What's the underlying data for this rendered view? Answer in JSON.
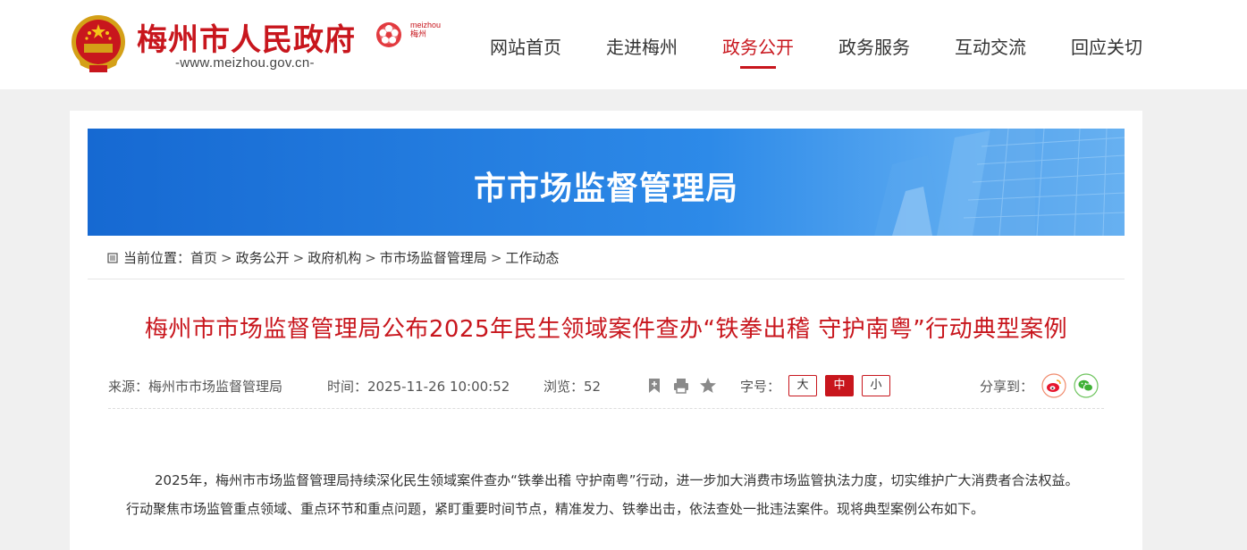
{
  "header": {
    "site_title": "梅州市人民政府",
    "site_url": "-www.meizhou.gov.cn-",
    "mz_logo_text_1": "meizhou",
    "mz_logo_text_2": "梅州"
  },
  "nav": {
    "items": [
      {
        "label": "网站首页",
        "active": false
      },
      {
        "label": "走进梅州",
        "active": false
      },
      {
        "label": "政务公开",
        "active": true
      },
      {
        "label": "政务服务",
        "active": false
      },
      {
        "label": "互动交流",
        "active": false
      },
      {
        "label": "回应关切",
        "active": false
      }
    ]
  },
  "banner": {
    "title": "市市场监督管理局"
  },
  "breadcrumb": {
    "prefix": "当前位置：",
    "items": [
      "首页",
      "政务公开",
      "政府机构",
      "市市场监督管理局",
      "工作动态"
    ],
    "separator": ">"
  },
  "article": {
    "title": "梅州市市场监督管理局公布2025年民生领域案件查办“铁拳出稽 守护南粤”行动典型案例",
    "source": "来源：梅州市市场监督管理局",
    "time": "时间：2025-11-26 10:00:52",
    "views": "浏览：52",
    "font_size_label": "字号：",
    "font_sizes": [
      "大",
      "中",
      "小"
    ],
    "font_size_selected": "中",
    "share_label": "分享到：",
    "body": "2025年，梅州市市场监督管理局持续深化民生领域案件查办“铁拳出稽 守护南粤”行动，进一步加大消费市场监管执法力度，切实维护广大消费者合法权益。行动聚焦市场监管重点领域、重点环节和重点问题，紧盯重要时间节点，精准发力、铁拳出击，依法查处一批违法案件。现将典型案例公布如下。"
  },
  "colors": {
    "brand_red": "#c8161d",
    "banner_blue": "#2a86e6",
    "weibo": "#e6162d",
    "wechat": "#3eb135"
  },
  "icons": [
    "emblem-icon",
    "meizhou-flower-icon",
    "breadcrumb-icon",
    "bookmark-icon",
    "print-icon",
    "favorite-star-icon",
    "weibo-icon",
    "wechat-icon"
  ]
}
